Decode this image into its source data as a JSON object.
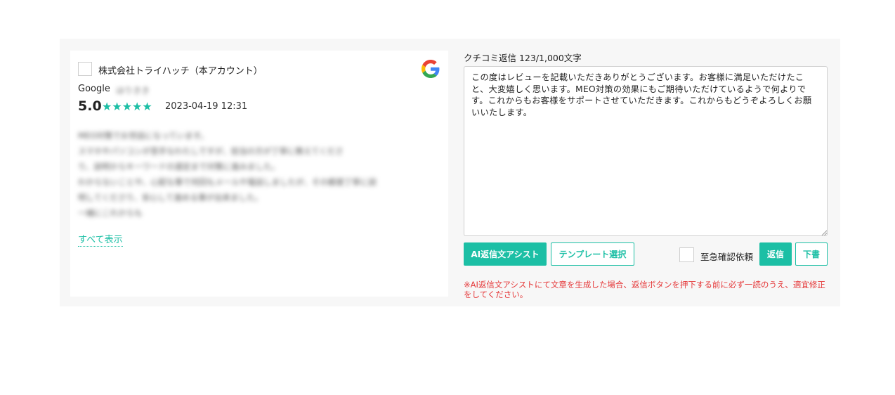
{
  "review": {
    "account_name": "株式会社トライハッチ（本アカウント）",
    "platform": "Google",
    "reviewer_name": "ほりきき",
    "rating": "5.0",
    "stars": "★★★★★",
    "date": "2023-04-19 12:31",
    "body_lines": [
      "MEO対策でお世話になっています。",
      "スマホやパソコンが苦手なわたしですが、担当の方が丁寧に教えてくださ",
      "り、説明からキーワードの選定まで対策に進みました。",
      "わからないことや、心配な事で何回もメールや電話しましたが、その都度丁寧に説",
      "明してくださり、安心して進める事が出来ました。",
      "一緒にこれからも"
    ],
    "show_all_label": "すべて表示",
    "google_logo_icon": "google-g-logo",
    "star_color": "#1cbfa5"
  },
  "reply": {
    "label": "クチコミ返信 123/1,000文字",
    "text": "この度はレビューを記載いただきありがとうございます。お客様に満足いただけたこと、大変嬉しく思います。MEO対策の効果にもご期待いただけているようで何よりです。これからもお客様をサポートさせていただきます。これからもどうぞよろしくお願いいたします。",
    "ai_assist_label": "AI返信文アシスト",
    "template_label": "テンプレート選択",
    "urgent_label": "至急確認依頼",
    "send_label": "返信",
    "draft_label": "下書",
    "warning": "※AI返信文アシストにて文章を生成した場合、返信ボタンを押下する前に必ず一読のうえ、適宜修正をしてください。"
  },
  "colors": {
    "accent": "#1cbfa5",
    "warning": "#e5393a",
    "panel_bg": "#f7f7f7"
  }
}
